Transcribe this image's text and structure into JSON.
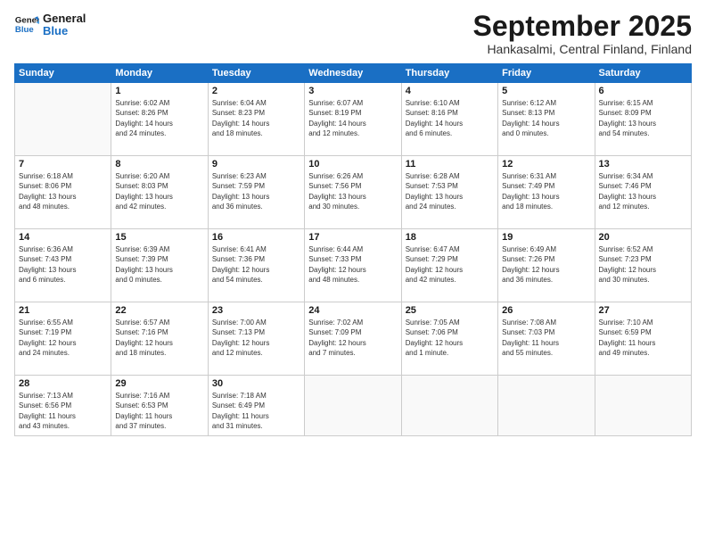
{
  "logo": {
    "line1": "General",
    "line2": "Blue"
  },
  "header": {
    "title": "September 2025",
    "subtitle": "Hankasalmi, Central Finland, Finland"
  },
  "days_of_week": [
    "Sunday",
    "Monday",
    "Tuesday",
    "Wednesday",
    "Thursday",
    "Friday",
    "Saturday"
  ],
  "weeks": [
    [
      {
        "day": "",
        "info": ""
      },
      {
        "day": "1",
        "info": "Sunrise: 6:02 AM\nSunset: 8:26 PM\nDaylight: 14 hours\nand 24 minutes."
      },
      {
        "day": "2",
        "info": "Sunrise: 6:04 AM\nSunset: 8:23 PM\nDaylight: 14 hours\nand 18 minutes."
      },
      {
        "day": "3",
        "info": "Sunrise: 6:07 AM\nSunset: 8:19 PM\nDaylight: 14 hours\nand 12 minutes."
      },
      {
        "day": "4",
        "info": "Sunrise: 6:10 AM\nSunset: 8:16 PM\nDaylight: 14 hours\nand 6 minutes."
      },
      {
        "day": "5",
        "info": "Sunrise: 6:12 AM\nSunset: 8:13 PM\nDaylight: 14 hours\nand 0 minutes."
      },
      {
        "day": "6",
        "info": "Sunrise: 6:15 AM\nSunset: 8:09 PM\nDaylight: 13 hours\nand 54 minutes."
      }
    ],
    [
      {
        "day": "7",
        "info": "Sunrise: 6:18 AM\nSunset: 8:06 PM\nDaylight: 13 hours\nand 48 minutes."
      },
      {
        "day": "8",
        "info": "Sunrise: 6:20 AM\nSunset: 8:03 PM\nDaylight: 13 hours\nand 42 minutes."
      },
      {
        "day": "9",
        "info": "Sunrise: 6:23 AM\nSunset: 7:59 PM\nDaylight: 13 hours\nand 36 minutes."
      },
      {
        "day": "10",
        "info": "Sunrise: 6:26 AM\nSunset: 7:56 PM\nDaylight: 13 hours\nand 30 minutes."
      },
      {
        "day": "11",
        "info": "Sunrise: 6:28 AM\nSunset: 7:53 PM\nDaylight: 13 hours\nand 24 minutes."
      },
      {
        "day": "12",
        "info": "Sunrise: 6:31 AM\nSunset: 7:49 PM\nDaylight: 13 hours\nand 18 minutes."
      },
      {
        "day": "13",
        "info": "Sunrise: 6:34 AM\nSunset: 7:46 PM\nDaylight: 13 hours\nand 12 minutes."
      }
    ],
    [
      {
        "day": "14",
        "info": "Sunrise: 6:36 AM\nSunset: 7:43 PM\nDaylight: 13 hours\nand 6 minutes."
      },
      {
        "day": "15",
        "info": "Sunrise: 6:39 AM\nSunset: 7:39 PM\nDaylight: 13 hours\nand 0 minutes."
      },
      {
        "day": "16",
        "info": "Sunrise: 6:41 AM\nSunset: 7:36 PM\nDaylight: 12 hours\nand 54 minutes."
      },
      {
        "day": "17",
        "info": "Sunrise: 6:44 AM\nSunset: 7:33 PM\nDaylight: 12 hours\nand 48 minutes."
      },
      {
        "day": "18",
        "info": "Sunrise: 6:47 AM\nSunset: 7:29 PM\nDaylight: 12 hours\nand 42 minutes."
      },
      {
        "day": "19",
        "info": "Sunrise: 6:49 AM\nSunset: 7:26 PM\nDaylight: 12 hours\nand 36 minutes."
      },
      {
        "day": "20",
        "info": "Sunrise: 6:52 AM\nSunset: 7:23 PM\nDaylight: 12 hours\nand 30 minutes."
      }
    ],
    [
      {
        "day": "21",
        "info": "Sunrise: 6:55 AM\nSunset: 7:19 PM\nDaylight: 12 hours\nand 24 minutes."
      },
      {
        "day": "22",
        "info": "Sunrise: 6:57 AM\nSunset: 7:16 PM\nDaylight: 12 hours\nand 18 minutes."
      },
      {
        "day": "23",
        "info": "Sunrise: 7:00 AM\nSunset: 7:13 PM\nDaylight: 12 hours\nand 12 minutes."
      },
      {
        "day": "24",
        "info": "Sunrise: 7:02 AM\nSunset: 7:09 PM\nDaylight: 12 hours\nand 7 minutes."
      },
      {
        "day": "25",
        "info": "Sunrise: 7:05 AM\nSunset: 7:06 PM\nDaylight: 12 hours\nand 1 minute."
      },
      {
        "day": "26",
        "info": "Sunrise: 7:08 AM\nSunset: 7:03 PM\nDaylight: 11 hours\nand 55 minutes."
      },
      {
        "day": "27",
        "info": "Sunrise: 7:10 AM\nSunset: 6:59 PM\nDaylight: 11 hours\nand 49 minutes."
      }
    ],
    [
      {
        "day": "28",
        "info": "Sunrise: 7:13 AM\nSunset: 6:56 PM\nDaylight: 11 hours\nand 43 minutes."
      },
      {
        "day": "29",
        "info": "Sunrise: 7:16 AM\nSunset: 6:53 PM\nDaylight: 11 hours\nand 37 minutes."
      },
      {
        "day": "30",
        "info": "Sunrise: 7:18 AM\nSunset: 6:49 PM\nDaylight: 11 hours\nand 31 minutes."
      },
      {
        "day": "",
        "info": ""
      },
      {
        "day": "",
        "info": ""
      },
      {
        "day": "",
        "info": ""
      },
      {
        "day": "",
        "info": ""
      }
    ]
  ]
}
